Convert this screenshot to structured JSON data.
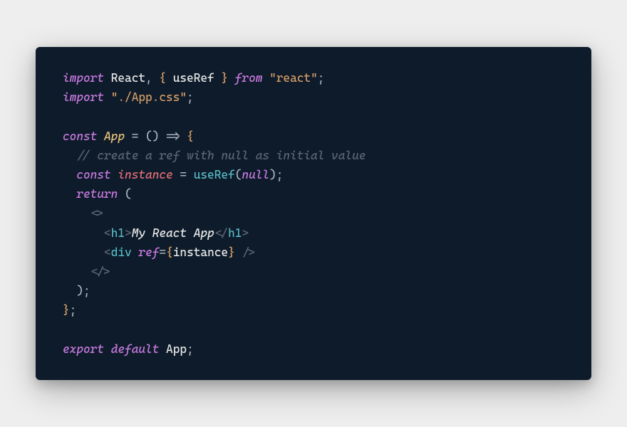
{
  "code": {
    "line1": {
      "import": "import",
      "react": "React",
      "comma": ",",
      "lbrace": "{",
      "useref": "useRef",
      "rbrace": "}",
      "from": "from",
      "pkg": "\"react\"",
      "semi": ";"
    },
    "line2": {
      "import": "import",
      "css": "\"./App.css\"",
      "semi": ";"
    },
    "line4": {
      "const": "const",
      "app": "App",
      "eq": "=",
      "lparen": "(",
      "rparen": ")",
      "arrow": "=>",
      "lbrace": "{"
    },
    "line5": {
      "comment": "// create a ref with null as initial value"
    },
    "line6": {
      "const": "const",
      "instance": "instance",
      "eq": "=",
      "useref": "useRef",
      "lparen": "(",
      "null": "null",
      "rparen": ")",
      "semi": ";"
    },
    "line7": {
      "return": "return",
      "lparen": "("
    },
    "line8": {
      "lt": "<",
      "gt": ">"
    },
    "line9": {
      "open_lt": "<",
      "open_tag": "h1",
      "open_gt": ">",
      "text": "My React App",
      "close_lt": "</",
      "close_tag": "h1",
      "close_gt": ">"
    },
    "line10": {
      "lt": "<",
      "tag": "div",
      "attr": "ref",
      "eq": "=",
      "lbrace": "{",
      "val": "instance",
      "rbrace": "}",
      "close": "/>"
    },
    "line11": {
      "lt": "<",
      "slash": "/",
      "gt": ">"
    },
    "line12": {
      "rparen": ")",
      "semi": ";"
    },
    "line13": {
      "rbrace": "}",
      "semi": ";"
    },
    "line15": {
      "export": "export",
      "default": "default",
      "app": "App",
      "semi": ";"
    }
  }
}
